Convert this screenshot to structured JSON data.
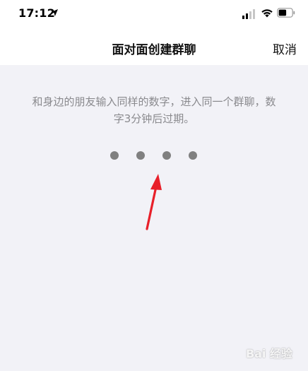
{
  "status_bar": {
    "time": "17:12",
    "icons": [
      "location-arrow-icon",
      "signal-icon",
      "wifi-icon",
      "battery-icon"
    ]
  },
  "nav": {
    "title": "面对面创建群聊",
    "cancel_label": "取消"
  },
  "main": {
    "instructions": "和身边的朋友输入同样的数字，进入同一个群聊，数字3分钟后过期。",
    "code_digits_entered": 0,
    "code_length": 4
  },
  "annotation": {
    "arrow_color": "#e8202a"
  },
  "watermark": {
    "text": "Bai 经验"
  },
  "colors": {
    "background": "#f2f2f7",
    "bar_background": "#ffffff",
    "dot": "#808080",
    "secondary_text": "#8a8a8e"
  }
}
